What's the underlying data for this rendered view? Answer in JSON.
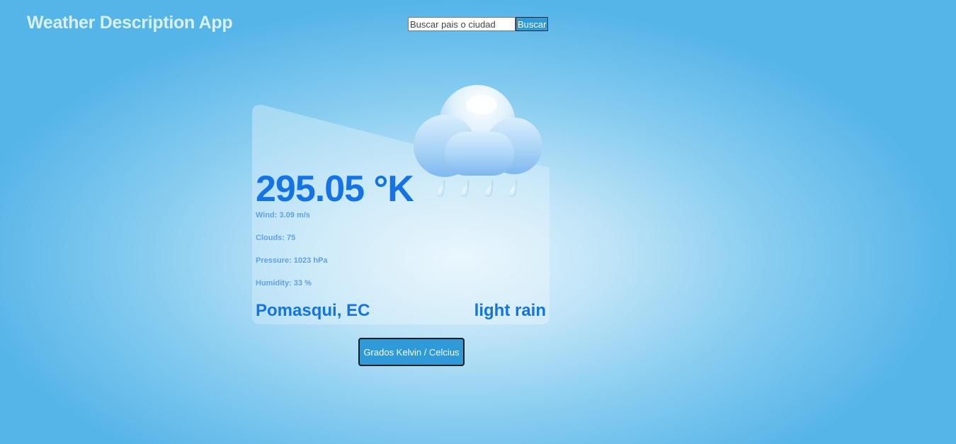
{
  "header": {
    "title": "Weather Description App"
  },
  "search": {
    "placeholder": "Buscar pais o ciudad",
    "value": "",
    "button_label": "Buscar"
  },
  "weather": {
    "icon": "cloud-rain-icon",
    "temperature": "295.05 °K",
    "wind": "Wind: 3.09 m/s",
    "clouds": "Clouds: 75",
    "pressure": "Pressure: 1023 hPa",
    "humidity": "Humidity: 33 %",
    "location": "Pomasqui, EC",
    "description": "light rain"
  },
  "toggle": {
    "label": "Grados Kelvin / Celcius"
  },
  "colors": {
    "background_edge": "#55b4e8",
    "background_center": "#e4f4fc",
    "accent_text": "#1473e6",
    "stat_text": "#5ea2e8",
    "button": "#2e9ad8",
    "title_text": "#d8f0fb"
  }
}
